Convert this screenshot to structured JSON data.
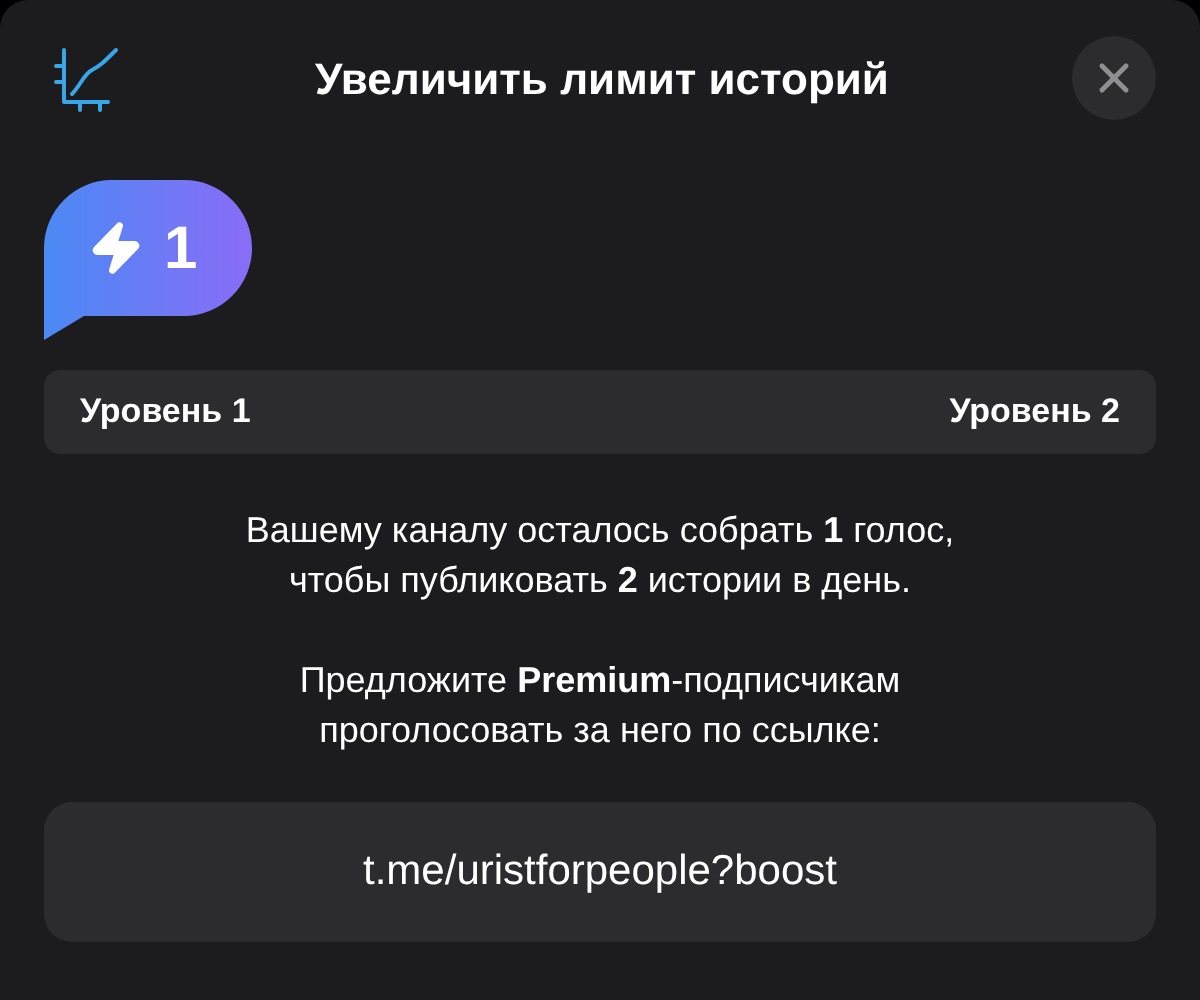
{
  "header": {
    "title": "Увеличить лимит историй"
  },
  "badge": {
    "count": "1"
  },
  "levels": {
    "current": "Уровень 1",
    "next": "Уровень 2"
  },
  "messages": [
    "Вашему каналу осталось собрать **1** голос,\nчтобы публиковать **2** истории в день.",
    "Предложите **Premium**-подписчикам\nпроголосовать за него по ссылке:"
  ],
  "link": "t.me/uristforpeople?boost"
}
